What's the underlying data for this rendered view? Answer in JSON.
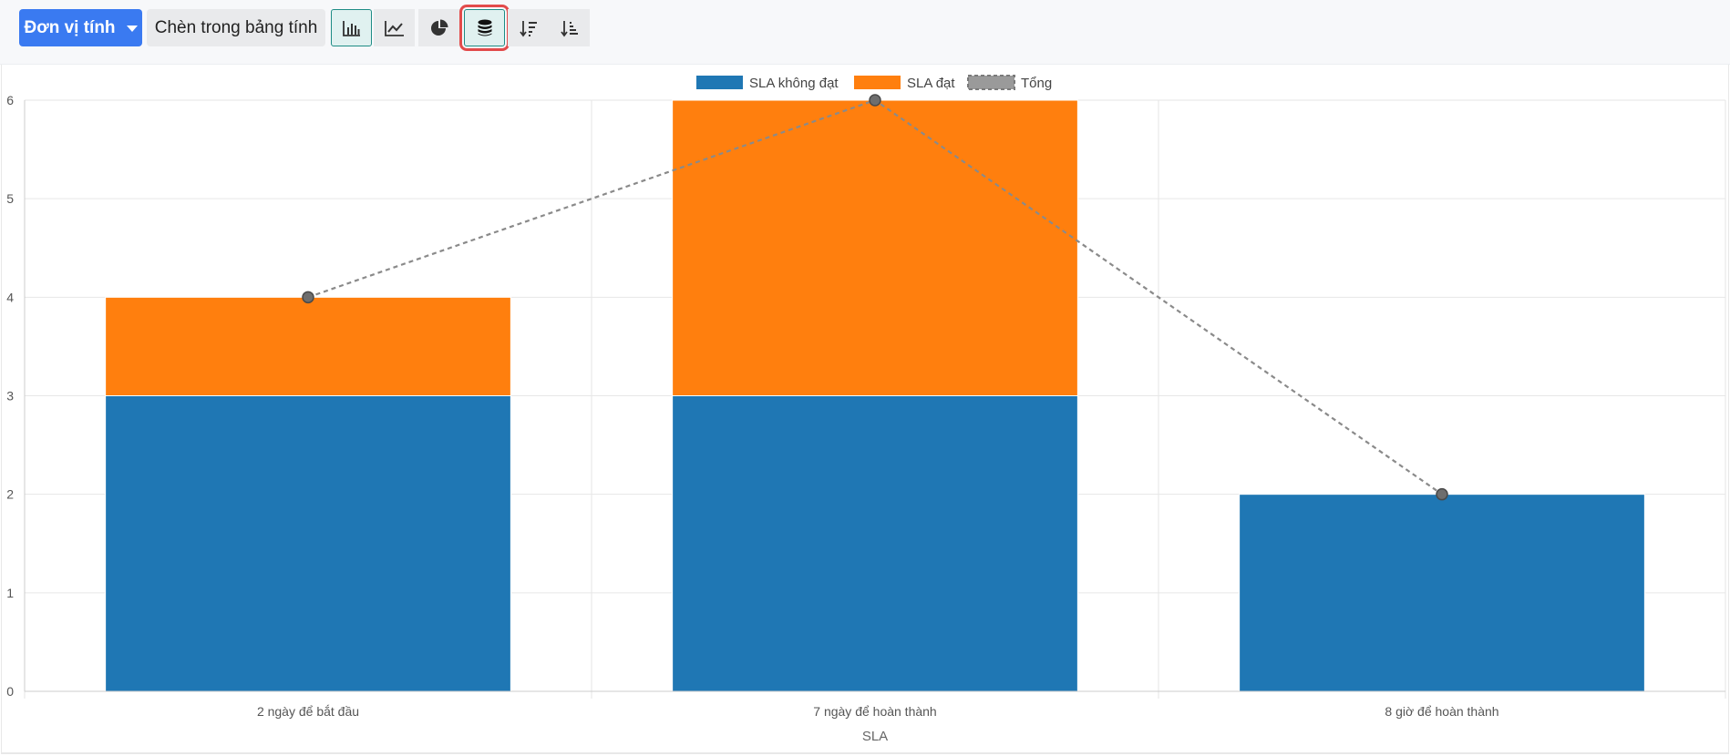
{
  "toolbar": {
    "measure_label": "Đơn vị tính",
    "insert_label": "Chèn trong bảng tính",
    "icons": [
      {
        "name": "bar-chart-icon",
        "active": true,
        "highlight": false
      },
      {
        "name": "line-chart-icon",
        "active": false,
        "highlight": false
      },
      {
        "name": "pie-chart-icon",
        "active": false,
        "highlight": false
      },
      {
        "name": "stacked-icon",
        "active": true,
        "highlight": true
      },
      {
        "name": "sort-descending-icon",
        "active": false,
        "highlight": false
      },
      {
        "name": "sort-ascending-icon",
        "active": false,
        "highlight": false
      }
    ]
  },
  "chart_data": {
    "type": "bar",
    "stacked": true,
    "categories": [
      "2 ngày để bắt đầu",
      "7 ngày để hoàn thành",
      "8 giờ để hoàn thành"
    ],
    "series": [
      {
        "name": "SLA không đạt",
        "type": "bar",
        "color": "#1f77b4",
        "values": [
          3,
          3,
          2
        ]
      },
      {
        "name": "SLA đạt",
        "type": "bar",
        "color": "#ff7f0e",
        "values": [
          1,
          3,
          0
        ]
      },
      {
        "name": "Tổng",
        "type": "line",
        "style": "dashed",
        "color": "#8a8a8a",
        "values": [
          4,
          6,
          2
        ]
      }
    ],
    "xlabel": "SLA",
    "ylabel": "",
    "ylim": [
      0,
      6
    ],
    "yticks": [
      0,
      1,
      2,
      3,
      4,
      5,
      6
    ],
    "grid": true,
    "legend": "top-center"
  }
}
